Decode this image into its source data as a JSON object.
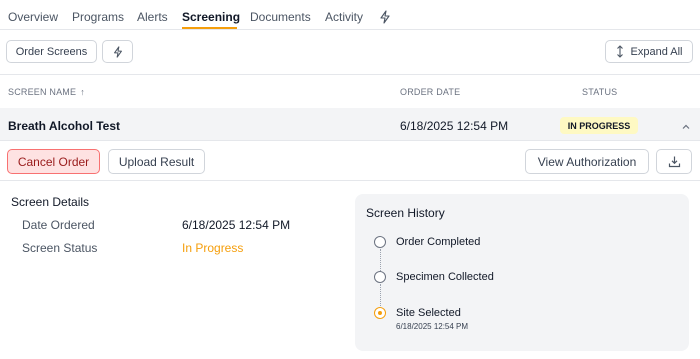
{
  "tabs": [
    {
      "label": "Overview"
    },
    {
      "label": "Programs"
    },
    {
      "label": "Alerts"
    },
    {
      "label": "Screening",
      "active": true
    },
    {
      "label": "Documents"
    },
    {
      "label": "Activity"
    }
  ],
  "toolbar": {
    "order_screens_label": "Order Screens",
    "expand_all_label": "Expand All"
  },
  "table": {
    "columns": [
      "SCREEN NAME",
      "ORDER DATE",
      "STATUS"
    ],
    "sort_indicator": "↑",
    "rows": [
      {
        "name": "Breath Alcohol Test",
        "order_date": "6/18/2025 12:54 PM",
        "status": "IN PROGRESS"
      }
    ]
  },
  "actions": {
    "cancel_label": "Cancel Order",
    "upload_label": "Upload Result",
    "view_auth_label": "View Authorization"
  },
  "details": {
    "title": "Screen Details",
    "date_ordered_label": "Date Ordered",
    "date_ordered_value": "6/18/2025 12:54 PM",
    "status_label": "Screen Status",
    "status_value": "In Progress"
  },
  "history": {
    "title": "Screen History",
    "items": [
      {
        "label": "Order Completed"
      },
      {
        "label": "Specimen Collected"
      },
      {
        "label": "Site Selected",
        "time": "6/18/2025 12:54 PM",
        "active": true
      }
    ]
  },
  "colors": {
    "accent": "#f59e0b",
    "badge_bg": "#fef9c3",
    "cancel_bg": "#fee2e2",
    "cancel_border": "#f87171"
  },
  "icons": [
    "bolt-icon",
    "expand-vertical-icon",
    "chevron-up-icon",
    "download-icon",
    "sort-ascending-icon"
  ]
}
